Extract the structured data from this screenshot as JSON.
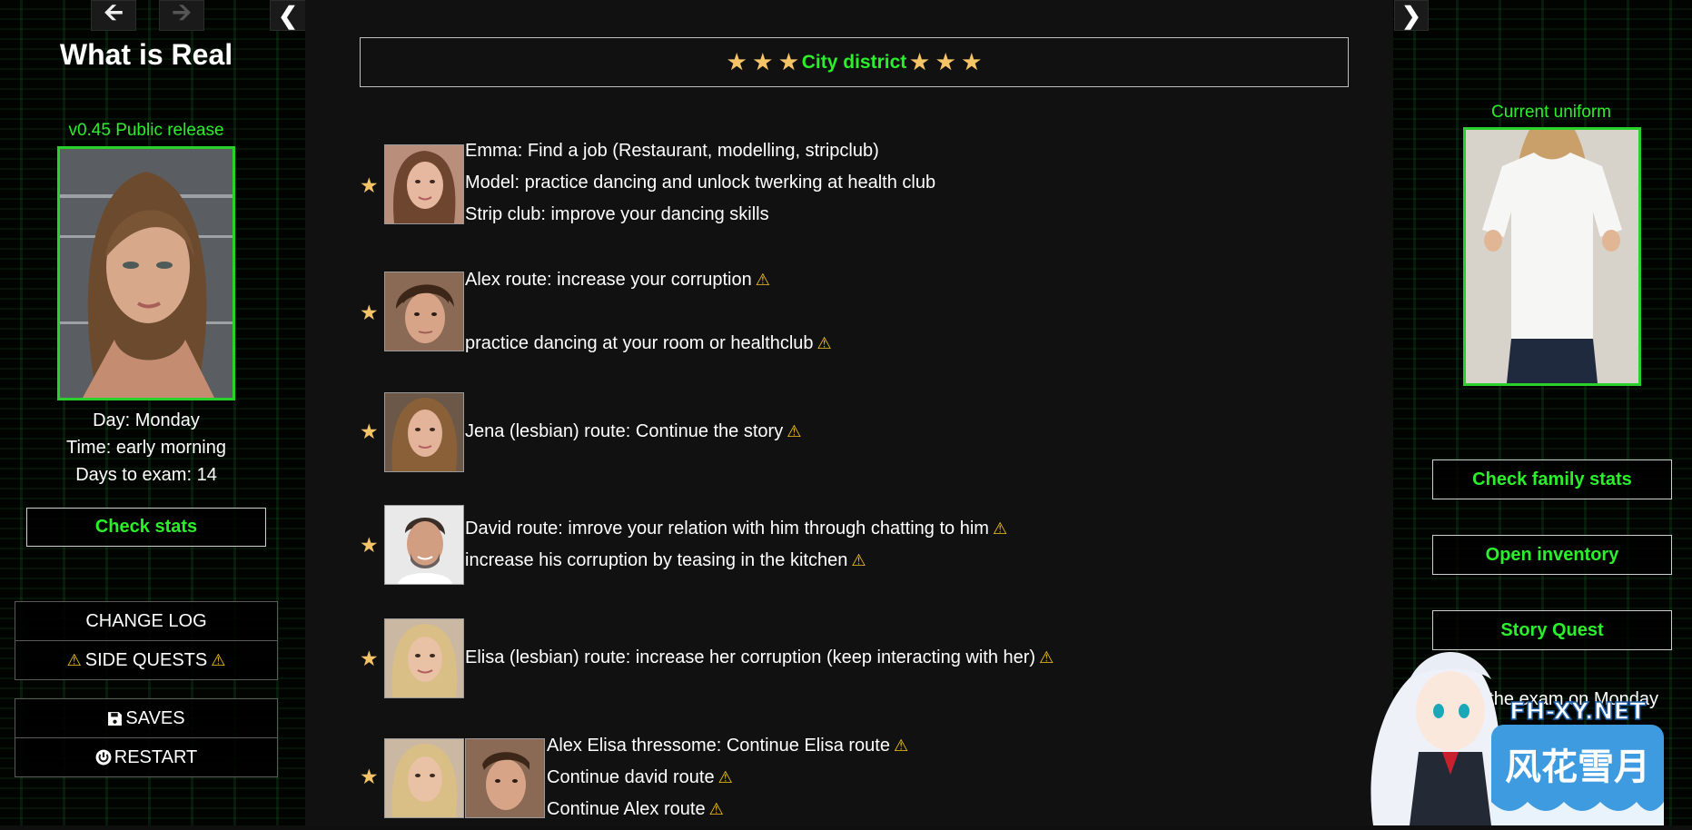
{
  "colors": {
    "accent_green": "#2cef2c",
    "star_gold": "#f4c467",
    "warning_yellow": "#f5c518",
    "background": "#0f0f0f"
  },
  "nav": {
    "back_icon": "arrow-left-icon",
    "forward_icon": "arrow-right-icon",
    "collapse_left_icon": "chevron-left-icon",
    "collapse_right_icon": "chevron-right-icon"
  },
  "sidebar": {
    "title": "What is Real",
    "version": "v0.45 Public release",
    "day": "Day: Monday",
    "time": "Time: early morning",
    "days_to_exam": "Days to exam: 14",
    "check_stats": "Check stats",
    "menu1": [
      "CHANGE LOG",
      "SIDE QUESTS"
    ],
    "menu2": [
      "SAVES",
      "RESTART"
    ]
  },
  "main": {
    "district_title": "City district",
    "quests": [
      {
        "lines": [
          "Emma: Find a job (Restaurant, modelling, stripclub)",
          "Model: practice dancing and unlock twerking at health club",
          "Strip club: improve your dancing skills"
        ]
      },
      {
        "lines": [
          "Alex route: increase your corruption",
          "practice dancing at your room or healthclub"
        ]
      },
      {
        "lines": [
          "Jena (lesbian) route: Continue the story"
        ]
      },
      {
        "lines": [
          "David route: imrove your relation with him through chatting to him",
          "increase his corruption by teasing in the kitchen"
        ]
      },
      {
        "lines": [
          "Elisa (lesbian) route: increase her corruption (keep interacting with her)"
        ]
      },
      {
        "lines": [
          "Alex Elisa thressome: Continue Elisa route",
          "Continue david route",
          "Continue Alex route"
        ]
      }
    ]
  },
  "right": {
    "uniform_label": "Current uniform",
    "check_family_stats": "Check family stats",
    "open_inventory": "Open inventory",
    "story_quest": "Story Quest",
    "exam_note": "e the exam on Monday"
  },
  "watermark": {
    "site": "FH-XY.NET",
    "chinese": "风花雪月"
  }
}
